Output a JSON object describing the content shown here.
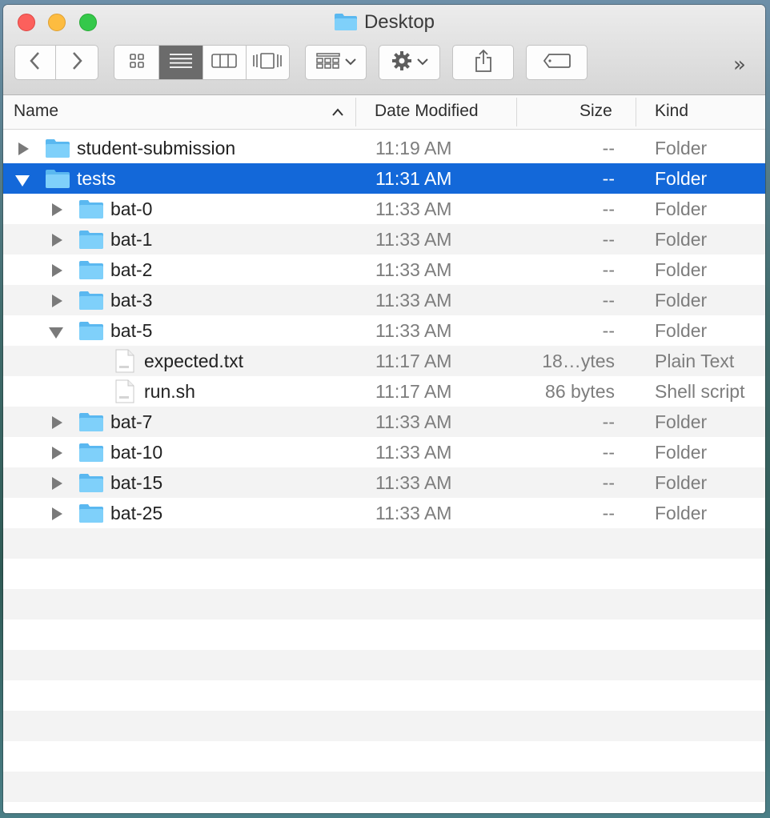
{
  "window": {
    "title": "Desktop",
    "title_icon": "folder-icon"
  },
  "toolbar": {
    "back_icon": "chevron-left-icon",
    "forward_icon": "chevron-right-icon",
    "view_modes": [
      "icon-view-icon",
      "list-view-icon",
      "column-view-icon",
      "cover-flow-icon"
    ],
    "active_view": "list",
    "arrange_icon": "arrange-grid-icon",
    "action_icon": "gear-icon",
    "share_icon": "share-icon",
    "tags_icon": "tag-icon",
    "overflow": "»"
  },
  "columns": {
    "name": "Name",
    "date": "Date Modified",
    "size": "Size",
    "kind": "Kind",
    "sort_indicator": "chevron-up-icon"
  },
  "rows": [
    {
      "name": "student-submission",
      "date": "11:19 AM",
      "size": "--",
      "kind": "Folder",
      "level": 0,
      "type": "folder",
      "expanded": false,
      "selected": false
    },
    {
      "name": "tests",
      "date": "11:31 AM",
      "size": "--",
      "kind": "Folder",
      "level": 0,
      "type": "folder",
      "expanded": true,
      "selected": true
    },
    {
      "name": "bat-0",
      "date": "11:33 AM",
      "size": "--",
      "kind": "Folder",
      "level": 1,
      "type": "folder",
      "expanded": false,
      "selected": false
    },
    {
      "name": "bat-1",
      "date": "11:33 AM",
      "size": "--",
      "kind": "Folder",
      "level": 1,
      "type": "folder",
      "expanded": false,
      "selected": false
    },
    {
      "name": "bat-2",
      "date": "11:33 AM",
      "size": "--",
      "kind": "Folder",
      "level": 1,
      "type": "folder",
      "expanded": false,
      "selected": false
    },
    {
      "name": "bat-3",
      "date": "11:33 AM",
      "size": "--",
      "kind": "Folder",
      "level": 1,
      "type": "folder",
      "expanded": false,
      "selected": false
    },
    {
      "name": "bat-5",
      "date": "11:33 AM",
      "size": "--",
      "kind": "Folder",
      "level": 1,
      "type": "folder",
      "expanded": true,
      "selected": false
    },
    {
      "name": "expected.txt",
      "date": "11:17 AM",
      "size": "18…ytes",
      "kind": "Plain Text",
      "level": 2,
      "type": "file",
      "expanded": false,
      "selected": false
    },
    {
      "name": "run.sh",
      "date": "11:17 AM",
      "size": "86 bytes",
      "kind": "Shell script",
      "level": 2,
      "type": "file",
      "expanded": false,
      "selected": false
    },
    {
      "name": "bat-7",
      "date": "11:33 AM",
      "size": "--",
      "kind": "Folder",
      "level": 1,
      "type": "folder",
      "expanded": false,
      "selected": false
    },
    {
      "name": "bat-10",
      "date": "11:33 AM",
      "size": "--",
      "kind": "Folder",
      "level": 1,
      "type": "folder",
      "expanded": false,
      "selected": false
    },
    {
      "name": "bat-15",
      "date": "11:33 AM",
      "size": "--",
      "kind": "Folder",
      "level": 1,
      "type": "folder",
      "expanded": false,
      "selected": false
    },
    {
      "name": "bat-25",
      "date": "11:33 AM",
      "size": "--",
      "kind": "Folder",
      "level": 1,
      "type": "folder",
      "expanded": false,
      "selected": false
    }
  ],
  "colors": {
    "selection": "#1368d9",
    "folder": "#6cc4f5",
    "close": "#fc605c",
    "minimize": "#fdbc40",
    "maximize": "#34c84a"
  }
}
